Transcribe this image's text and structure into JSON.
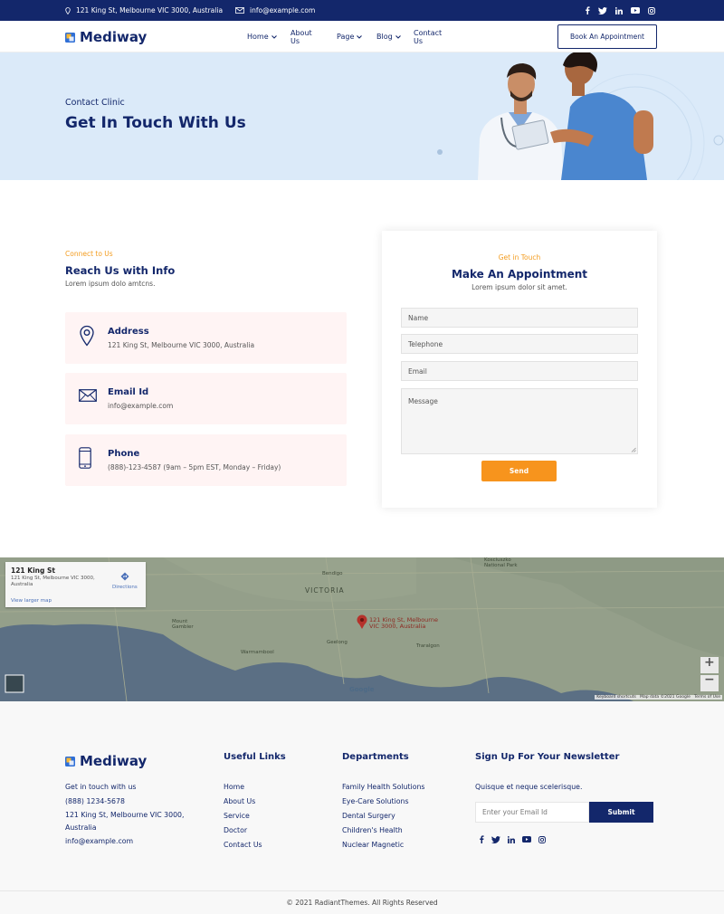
{
  "topbar": {
    "address": "121 King St, Melbourne VIC 3000, Australia",
    "email": "info@example.com"
  },
  "header": {
    "logo_text": "Mediway",
    "nav": [
      {
        "label": "Home"
      },
      {
        "label": "About Us"
      },
      {
        "label": "Page"
      },
      {
        "label": "Blog"
      },
      {
        "label": "Contact Us"
      }
    ],
    "book_button": "Book An Appointment"
  },
  "hero": {
    "kicker": "Contact Clinic",
    "title": "Get In Touch With Us"
  },
  "contact": {
    "kicker": "Connect to Us",
    "title": "Reach Us with Info",
    "subtitle": "Lorem ipsum dolo amtcns.",
    "cards": [
      {
        "title": "Address",
        "detail": "121 King St, Melbourne VIC 3000, Australia",
        "icon": "map-pin-icon"
      },
      {
        "title": "Email Id",
        "detail": "info@example.com",
        "icon": "envelope-icon"
      },
      {
        "title": "Phone",
        "detail": "(888)-123-4587 (9am – 5pm EST, Monday – Friday)",
        "icon": "phone-icon"
      }
    ]
  },
  "form": {
    "kicker": "Get in Touch",
    "title": "Make An Appointment",
    "subtitle": "Lorem ipsum dolor sit amet.",
    "fields": {
      "name": "Name",
      "telephone": "Telephone",
      "email": "Email",
      "message": "Message"
    },
    "send": "Send"
  },
  "map": {
    "place_title": "121 King St",
    "place_address": "121 King St, Melbourne VIC 3000, Australia",
    "view_larger": "View larger map",
    "directions": "Directions",
    "region_label": "VICTORIA",
    "marker_label": "121 King St, Melbourne VIC 3000, Australia",
    "attribution": "Keyboard shortcuts   Map data ©2021 Google   Terms of Use",
    "google": "Google",
    "towns": [
      "Bendigo",
      "Warrnambool",
      "Geelong",
      "Traralgon",
      "Mount Gambier",
      "Kosciuszko National Park"
    ]
  },
  "footer": {
    "logo_text": "Mediway",
    "contact_lines": [
      "Get in touch with us",
      "(888) 1234-5678",
      "121 King St, Melbourne VIC 3000,",
      "Australia",
      "info@example.com"
    ],
    "useful_title": "Useful Links",
    "useful_links": [
      "Home",
      "About Us",
      "Service",
      "Doctor",
      "Contact Us"
    ],
    "dept_title": "Departments",
    "departments": [
      "Family Health Solutions",
      "Eye-Care Solutions",
      "Dental Surgery",
      "Children's Health",
      "Nuclear Magnetic"
    ],
    "newsletter_title": "Sign Up For Your Newsletter",
    "newsletter_text": "Quisque et neque scelerisque.",
    "email_placeholder": "Enter your Email Id",
    "submit": "Submit",
    "copyright": "© 2021 RadiantThemes. All Rights Reserved"
  },
  "colors": {
    "navy": "#13276b",
    "orange": "#f7941d",
    "hero_bg": "#dbeaf9",
    "card_bg": "#fff4f4"
  }
}
